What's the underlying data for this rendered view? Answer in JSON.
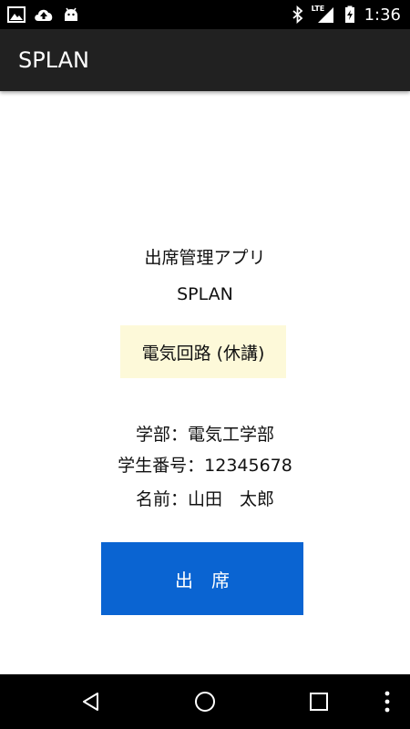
{
  "status_bar": {
    "time": "1:36",
    "left_icons": [
      "image-icon",
      "cloud-upload-icon",
      "android-icon"
    ],
    "right_icons": [
      "bluetooth-icon",
      "lte-signal-icon",
      "battery-charging-icon"
    ],
    "network_label": "LTE"
  },
  "app_bar": {
    "title": "SPLAN"
  },
  "main": {
    "subtitle": "出席管理アプリ",
    "app_name": "SPLAN",
    "course": "電気回路 (休講)",
    "faculty_line": "学部：電気工学部",
    "student_id_line": "学生番号：12345678",
    "name_line": "名前：山田　太郎",
    "attend_button_label": "出　席"
  },
  "nav_bar": {
    "buttons": [
      "back-icon",
      "home-icon",
      "recents-icon",
      "more-vert-icon"
    ]
  },
  "colors": {
    "status_bar": "#000000",
    "app_bar": "#212121",
    "course_box": "#fdf9d9",
    "attend_button": "#0a64d2",
    "nav_bar": "#000000"
  }
}
